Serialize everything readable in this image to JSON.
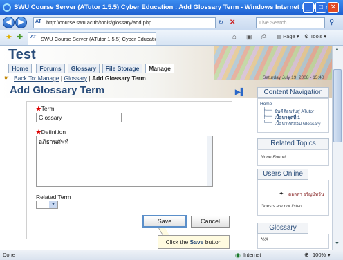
{
  "window": {
    "title": "SWU Course Server (ATutor 1.5.5) Cyber Education : Add Glossary Term - Windows Internet Explorer"
  },
  "toolbar": {
    "url": "http://course.swu.ac.th/tools/glossary/add.php",
    "search_placeholder": "Live Search",
    "tab_label": "SWU Course Server (ATutor 1.5.5) Cyber Education :...",
    "page_menu": "Page",
    "tools_menu": "Tools"
  },
  "site": {
    "title": "Test",
    "nav": [
      "Home",
      "Forums",
      "Glossary",
      "File Storage",
      "Manage"
    ],
    "date": "Saturday July 19, 2008 - 15:40"
  },
  "breadcrumb": {
    "back": "Back To: Manage",
    "glossary": "Glossary",
    "sep": "|",
    "current": "Add Glossary Term"
  },
  "page_title": "Add Glossary Term",
  "form": {
    "term_label": "Term",
    "term_value": "Glossary",
    "definition_label": "Definition",
    "definition_value": "อภิธานศัพท์",
    "related_label": "Related Term",
    "save_label": "Save",
    "cancel_label": "Cancel"
  },
  "callout": {
    "prefix": "Click the ",
    "bold": "Save",
    "suffix": " button"
  },
  "sidebar": {
    "content_nav": {
      "title": "Content Navigation",
      "home": "Home",
      "items": [
        "ยินดีต้อนรับสู่ ATutor",
        "เนื้อหาชุดที่ 1",
        "เนื้อหาทดสอบ Glossary"
      ]
    },
    "related": {
      "title": "Related Topics",
      "text": "None Found."
    },
    "users": {
      "title": "Users Online",
      "user": "ดอลลา อรัญนิทวัน",
      "guests": "Guests are not listed"
    },
    "glossary": {
      "title": "Glossary",
      "text": "N/A"
    }
  },
  "status": {
    "left": "Done",
    "zone": "Internet",
    "zoom": "100%"
  },
  "colors": {
    "title_blue": "#2a4d7a",
    "required": "#dd0000",
    "titlebar": "#1d5fd0"
  }
}
